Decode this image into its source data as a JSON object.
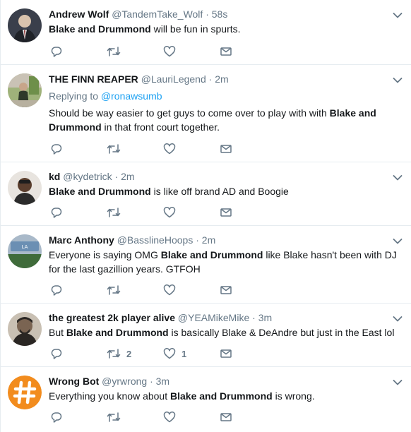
{
  "tweets": [
    {
      "name": "Andrew Wolf",
      "handle": "@TandemTake_Wolf",
      "time": "58s",
      "reply_to": null,
      "text_parts": [
        {
          "t": "Blake and Drummond",
          "b": true
        },
        {
          "t": " will be fun in spurts.",
          "b": false
        }
      ],
      "replies": "",
      "retweets": "",
      "likes": "",
      "avatar_colors": [
        "#3a3f4b",
        "#d9d3cc",
        "#8a2a2a"
      ]
    },
    {
      "name": "THE FINN REAPER",
      "handle": "@LauriLegend",
      "time": "2m",
      "reply_to": {
        "label": "Replying to",
        "mention": "@ronawsumb"
      },
      "text_parts": [
        {
          "t": "Should be way easier to get guys to come over to play with with ",
          "b": false
        },
        {
          "t": "Blake and Drummond",
          "b": true
        },
        {
          "t": " in that front court together.",
          "b": false
        }
      ],
      "replies": "",
      "retweets": "",
      "likes": "",
      "avatar_colors": [
        "#6e8f4a",
        "#c9c2b5",
        "#2f3a2a"
      ]
    },
    {
      "name": "kd",
      "handle": "@kydetrick",
      "time": "2m",
      "reply_to": null,
      "text_parts": [
        {
          "t": "Blake and Drummond",
          "b": true
        },
        {
          "t": " is like off brand AD and Boogie",
          "b": false
        }
      ],
      "replies": "",
      "retweets": "",
      "likes": "",
      "avatar_colors": [
        "#e8e4df",
        "#5a3e2e",
        "#2b2b2b"
      ]
    },
    {
      "name": "Marc Anthony",
      "handle": "@BasslineHoops",
      "time": "2m",
      "reply_to": null,
      "text_parts": [
        {
          "t": "Everyone is saying OMG ",
          "b": false
        },
        {
          "t": "Blake and Drummond",
          "b": true
        },
        {
          "t": " like Blake hasn't been with DJ for the last gazillion years. GTFOH",
          "b": false
        }
      ],
      "replies": "",
      "retweets": "",
      "likes": "",
      "avatar_colors": [
        "#6b8fb3",
        "#3f6b3a",
        "#a9b9c9"
      ]
    },
    {
      "name": "the greatest 2k player alive",
      "handle": "@YEAMikeMike",
      "time": "3m",
      "reply_to": null,
      "text_parts": [
        {
          "t": "But ",
          "b": false
        },
        {
          "t": "Blake and Drummond",
          "b": true
        },
        {
          "t": " is basically Blake & DeAndre but just in the East lol",
          "b": false
        }
      ],
      "replies": "",
      "retweets": "2",
      "likes": "1",
      "avatar_colors": [
        "#2a2623",
        "#7a6452",
        "#c9c0b3"
      ]
    },
    {
      "name": "Wrong Bot",
      "handle": "@yrwrong",
      "time": "3m",
      "reply_to": null,
      "text_parts": [
        {
          "t": "Everything you know about ",
          "b": false
        },
        {
          "t": "Blake and Drummond",
          "b": true
        },
        {
          "t": " is wrong.",
          "b": false
        }
      ],
      "replies": "",
      "retweets": "",
      "likes": "",
      "avatar_colors": [
        "#f28c1e",
        "#ffffff",
        "#f28c1e"
      ]
    }
  ],
  "icons": {
    "reply": "reply-icon",
    "retweet": "retweet-icon",
    "like": "like-icon",
    "dm": "direct-message-icon",
    "caret": "chevron-down-icon"
  },
  "colors": {
    "text": "#14171a",
    "secondary": "#657786",
    "link": "#1da1f2",
    "border": "#e6ecf0"
  }
}
